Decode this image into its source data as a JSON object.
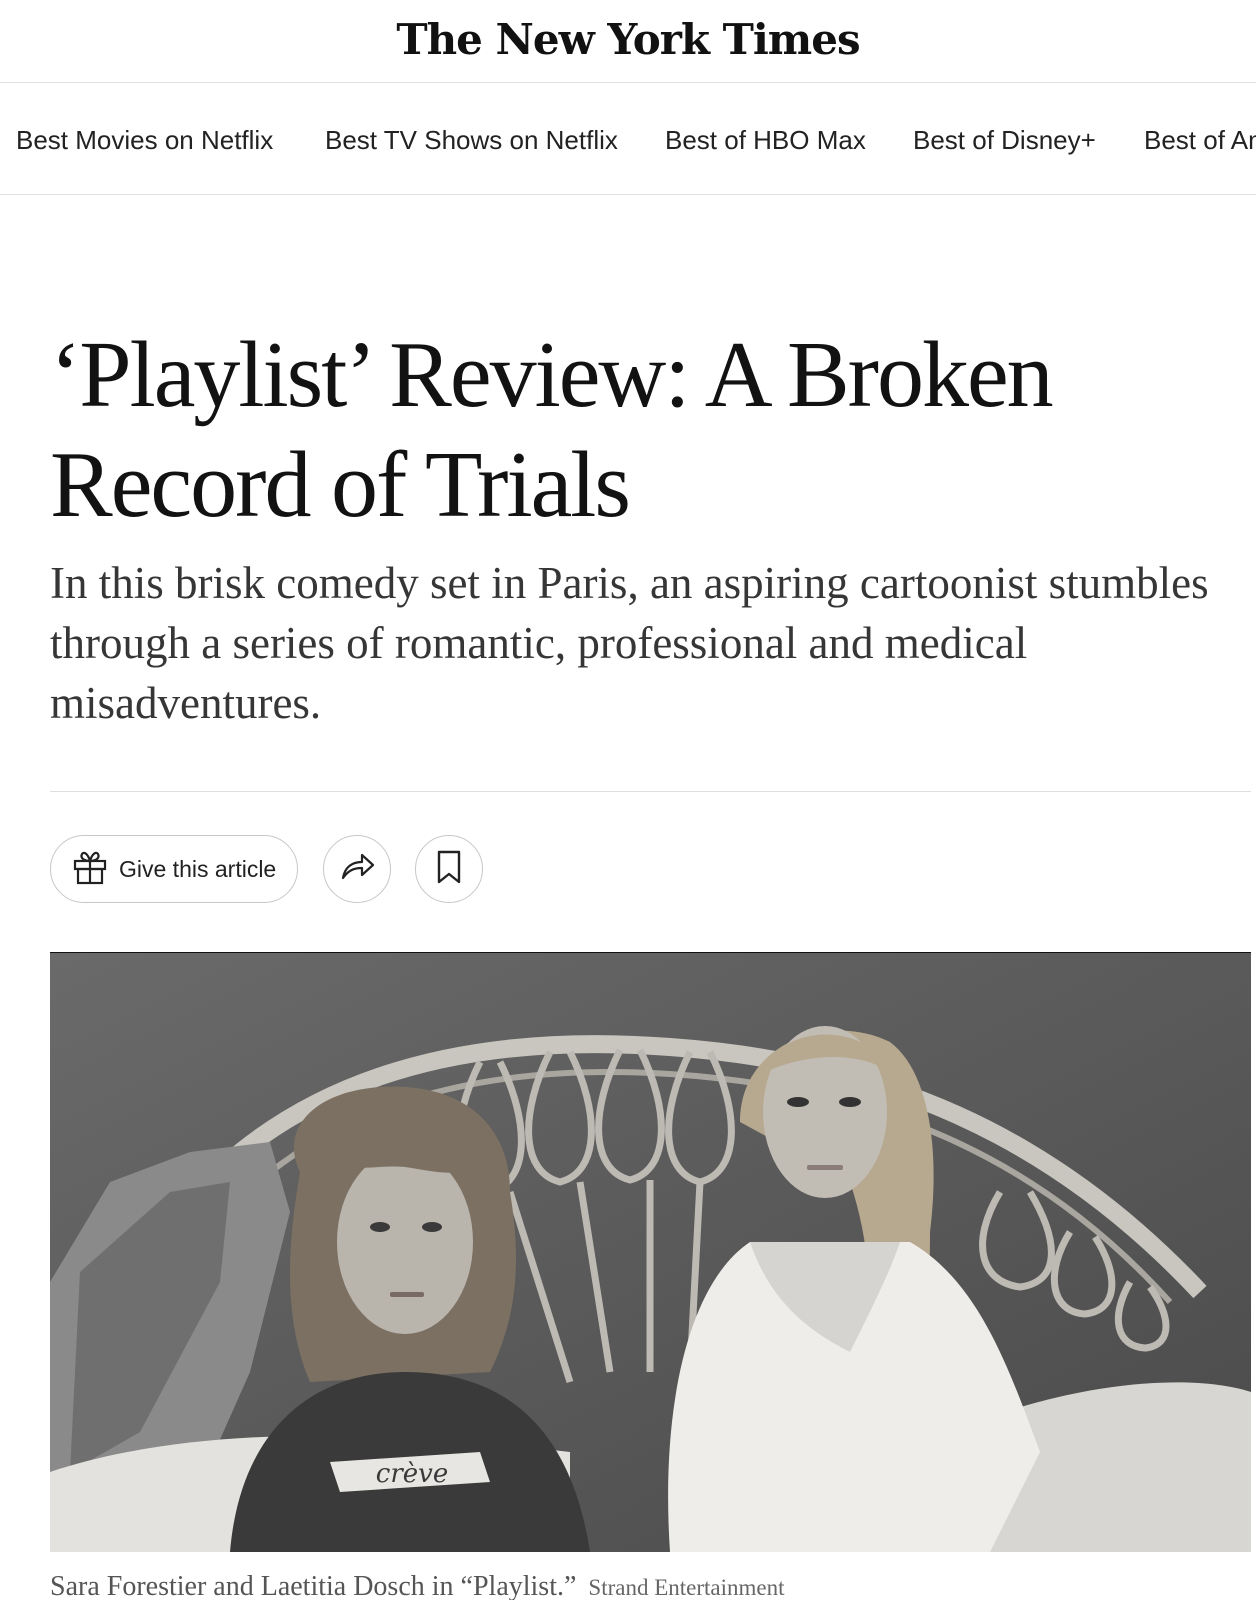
{
  "masthead": {
    "logo": "The New York Times"
  },
  "nav": {
    "items": [
      {
        "label": "Best Movies on Netflix"
      },
      {
        "label": "Best TV Shows on Netflix"
      },
      {
        "label": "Best of HBO Max"
      },
      {
        "label": "Best of Disney+"
      },
      {
        "label": "Best of Amazon Prime"
      }
    ]
  },
  "article": {
    "headline_line1": "‘Playlist’ Review: A Broken",
    "headline_line2": "Record of Trials",
    "summary": "In this brisk comedy set in Paris, an aspiring cartoonist stumbles through a series of romantic, professional and medical misadventures."
  },
  "actions": {
    "give_label": "Give this article",
    "icons": [
      "gift-icon",
      "share-icon",
      "bookmark-icon"
    ]
  },
  "image": {
    "shirt_text": "crève",
    "caption": "Sara Forestier and Laetitia Dosch in “Playlist.”",
    "credit": "Strand Entertainment"
  }
}
